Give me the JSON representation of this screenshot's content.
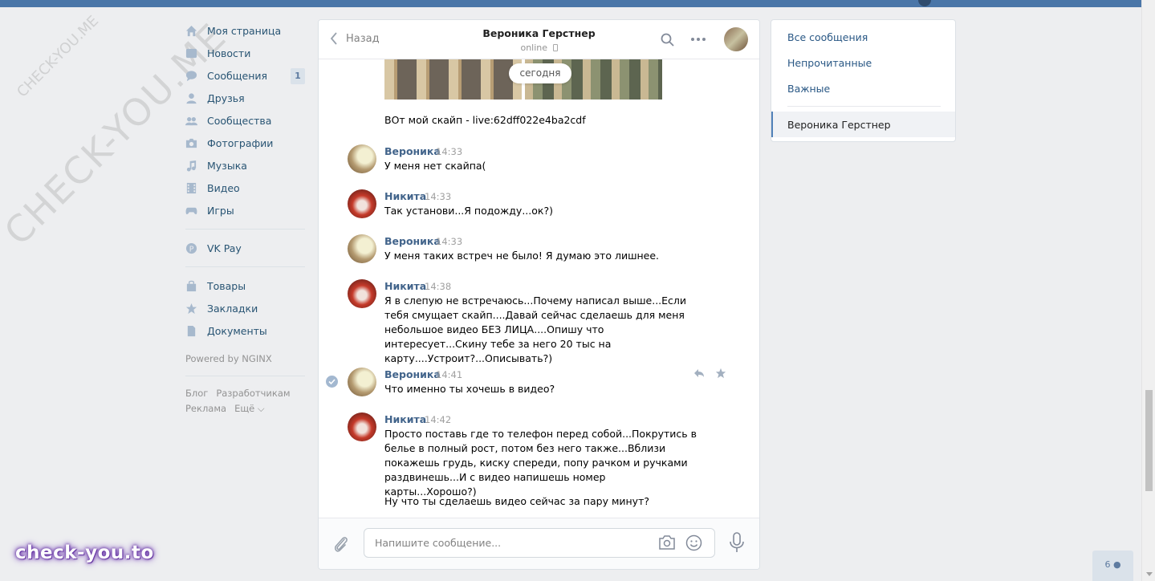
{
  "watermark": {
    "big": "CHECK-YOU.ME",
    "small": "CHECK-YOU.ME"
  },
  "brand": "check-you.to",
  "nav": {
    "items": [
      {
        "label": "Моя страница",
        "icon": "home-icon"
      },
      {
        "label": "Новости",
        "icon": "news-icon"
      },
      {
        "label": "Сообщения",
        "icon": "messages-icon",
        "count": "1"
      },
      {
        "label": "Друзья",
        "icon": "friend-icon"
      },
      {
        "label": "Сообщества",
        "icon": "groups-icon"
      },
      {
        "label": "Фотографии",
        "icon": "camera-icon"
      },
      {
        "label": "Музыка",
        "icon": "music-icon"
      },
      {
        "label": "Видео",
        "icon": "video-icon"
      },
      {
        "label": "Игры",
        "icon": "gamepad-icon"
      }
    ],
    "vkpay": {
      "label": "VK Pay",
      "icon": "vkpay-icon"
    },
    "extra": [
      {
        "label": "Товары",
        "icon": "bag-icon"
      },
      {
        "label": "Закладки",
        "icon": "star-icon"
      },
      {
        "label": "Документы",
        "icon": "document-icon"
      }
    ],
    "powered": "Powered by NGINX",
    "footer_links": [
      "Блог",
      "Разработчикам",
      "Реклама",
      "Ещё ⌵"
    ]
  },
  "chat": {
    "back_label": "Назад",
    "title": "Вероника Герстнер",
    "status": "online",
    "date_badge": "сегодня",
    "first_text": "ВОт мой скайп - live:62dff022e4ba2cdf",
    "messages": [
      {
        "name": "Вероника",
        "time": "14:33",
        "who": "ver",
        "text": "У меня нет скайпа("
      },
      {
        "name": "Никита",
        "time": "14:33",
        "who": "nik",
        "text": "Так установи...Я подожду...ок?)"
      },
      {
        "name": "Вероника",
        "time": "14:33",
        "who": "ver",
        "text": "У меня таких встреч не было! Я думаю это лишнее."
      },
      {
        "name": "Никита",
        "time": "14:38",
        "who": "nik",
        "text": "Я в слепую не встречаюсь...Почему написал выше...Если тебя смущает скайп....Давай сейчас сделаешь для меня небольшое видео БЕЗ ЛИЦА....Опишу что интересует...Скину тебе за него 20 тыс на карту....Устроит?...Описывать?)"
      },
      {
        "name": "Вероника",
        "time": "14:41",
        "who": "ver",
        "text": "Что именно ты хочешь в видео?"
      },
      {
        "name": "Никита",
        "time": "14:42",
        "who": "nik",
        "text": "Просто поставь где то телефон перед собой...Покрутись в белье в полный рост, потом без него также...Вблизи покажешь грудь, киску спереди, попу рачком и ручками раздвинешь...И с видео напишешь номер карты...Хорошо?)"
      }
    ],
    "last_text": "Ну что ты сделаешь видео сейчас за пару минут?",
    "composer_placeholder": "Напишите сообщение..."
  },
  "right_menu": {
    "items": [
      "Все сообщения",
      "Непрочитанные",
      "Важные"
    ],
    "active": "Вероника Герстнер"
  },
  "online_count": "6"
}
